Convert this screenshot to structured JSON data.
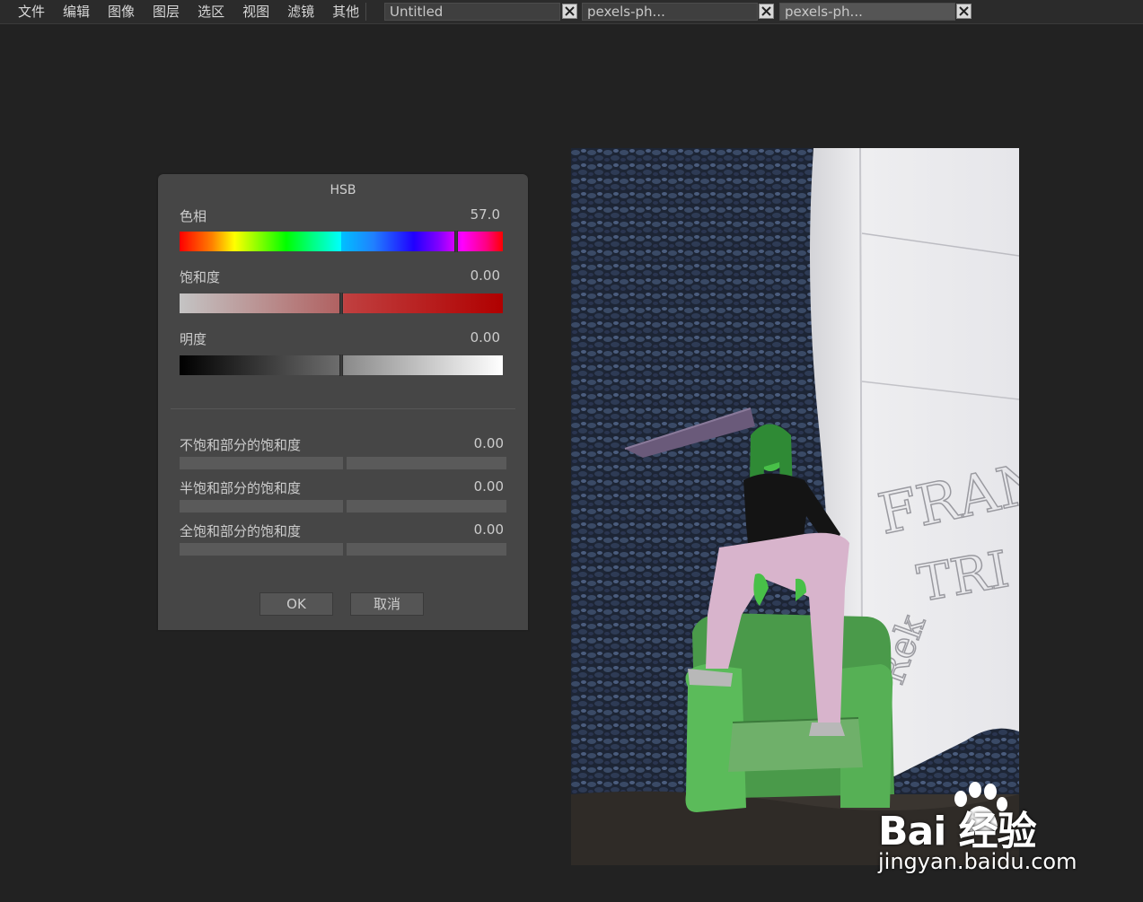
{
  "menubar": {
    "items": [
      "文件",
      "编辑",
      "图像",
      "图层",
      "选区",
      "视图",
      "滤镜",
      "其他"
    ]
  },
  "tabs": [
    {
      "label": "Untitled"
    },
    {
      "label": "pexels-ph..."
    },
    {
      "label": "pexels-ph..."
    }
  ],
  "dialog": {
    "title": "HSB",
    "hue": {
      "label": "色相",
      "value": "57.0"
    },
    "saturation": {
      "label": "饱和度",
      "value": "0.00"
    },
    "brightness": {
      "label": "明度",
      "value": "0.00"
    },
    "unsaturated": {
      "label": "不饱和部分的饱和度",
      "value": "0.00"
    },
    "half_saturated": {
      "label": "半饱和部分的饱和度",
      "value": "0.00"
    },
    "full_saturated": {
      "label": "全饱和部分的饱和度",
      "value": "0.00"
    },
    "ok_label": "OK",
    "cancel_label": "取消"
  },
  "watermark": {
    "brand": "Bai 经验",
    "url": "jingyan.baidu.com"
  },
  "colors": {
    "background": "#222222",
    "dialog": "#464646",
    "menubar": "#2b2b2b"
  }
}
